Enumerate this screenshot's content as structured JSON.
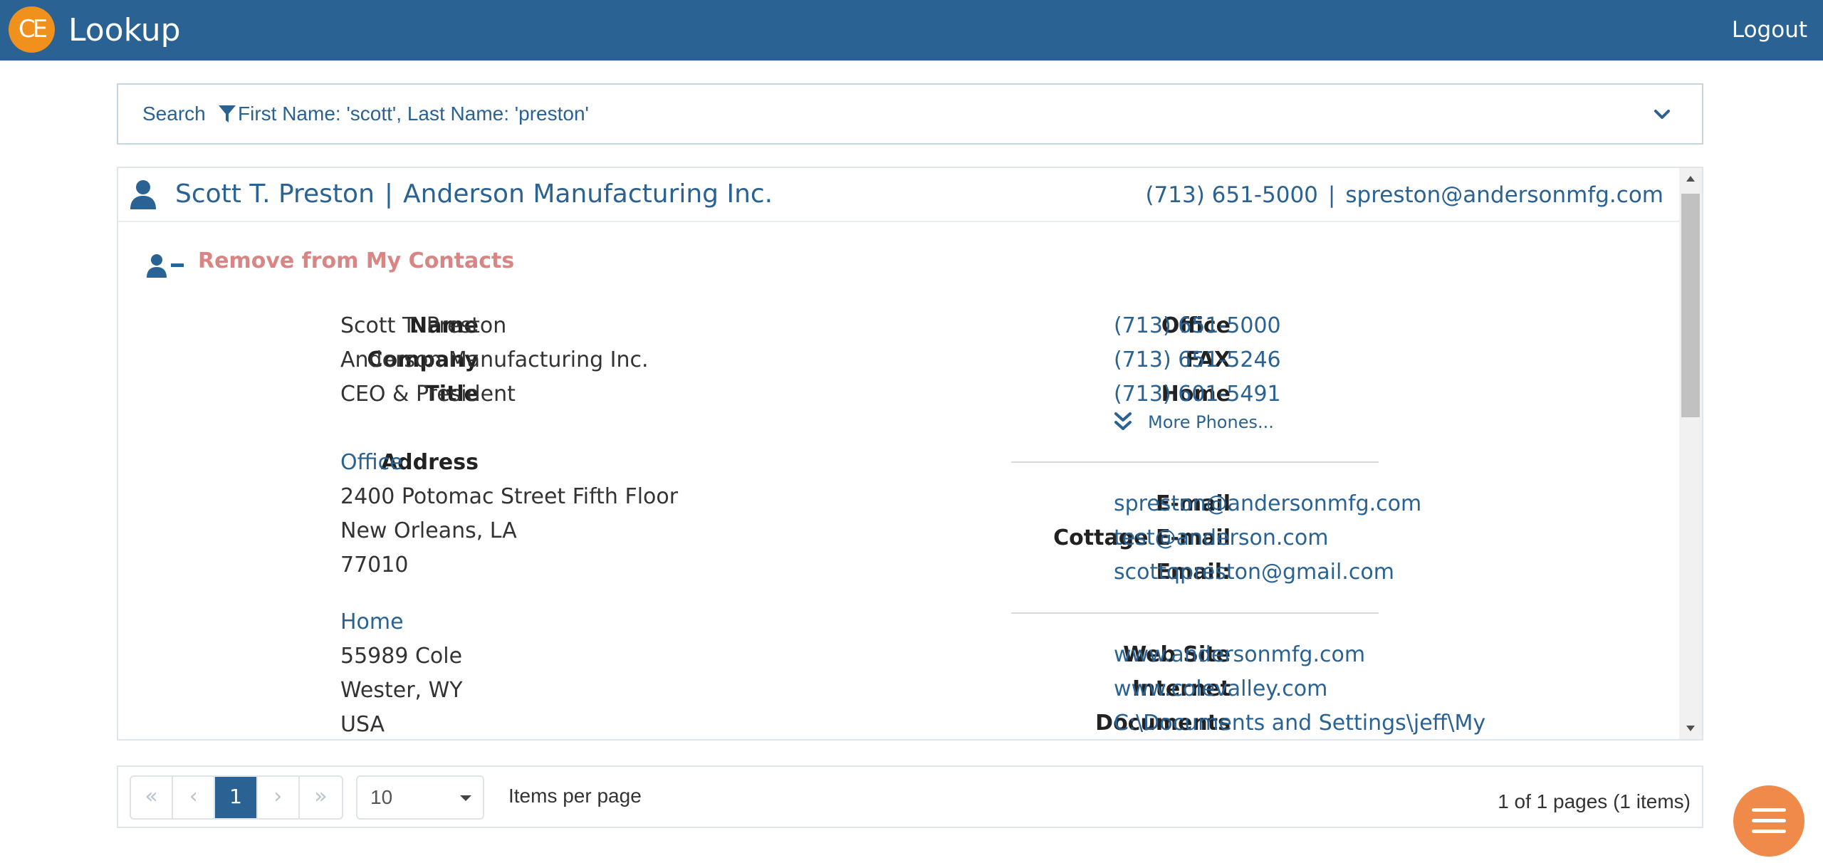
{
  "app": {
    "logo_text": "CE",
    "title": "Lookup",
    "logout_label": "Logout",
    "brand_color": "#2a6293",
    "accent_color": "#f0911d"
  },
  "search": {
    "label": "Search",
    "filter_icon": "filter-icon",
    "filter_text": "First Name: 'scott', Last Name: 'preston'",
    "toggle_icon": "chevron-down-icon"
  },
  "contact": {
    "header": {
      "name": "Scott T. Preston",
      "separator": "|",
      "company": "Anderson Manufacturing Inc.",
      "phone": "(713) 651-5000",
      "email": "spreston@andersonmfg.com"
    },
    "remove_label": "Remove from My Contacts",
    "remove_color": "#d98583",
    "left": {
      "name_label": "Name",
      "name": "Scott T. Preston",
      "company_label": "Company",
      "company": "Anderson Manufacturing Inc.",
      "title_label": "Title",
      "title": "CEO & President",
      "address_label": "Address",
      "addresses": [
        {
          "type": "Office",
          "line1": "2400 Potomac Street Fifth Floor",
          "line2": "New Orleans, LA",
          "line3": "77010"
        },
        {
          "type": "Home",
          "line1": "55989 Cole",
          "line2": "Wester, WY",
          "line3": "USA"
        }
      ]
    },
    "phones": [
      {
        "label": "Office",
        "value": "(713) 651-5000"
      },
      {
        "label": "FAX",
        "value": "(713) 651-5246"
      },
      {
        "label": "Home",
        "value": "(713) 601-5491"
      }
    ],
    "more_phones_label": "More Phones...",
    "emails": [
      {
        "label": "E-mail",
        "value": "spreston@andersonmfg.com"
      },
      {
        "label": "Cottage E-mail",
        "value": "test@anderson.com"
      },
      {
        "label": "Email:",
        "value": "scottqpreston@gmail.com"
      }
    ],
    "web": [
      {
        "label": "Web Site",
        "value": "www.andersonmfg.com"
      },
      {
        "label": "Internet",
        "value": "www.colevalley.com"
      },
      {
        "label": "Documents",
        "value": "C:\\Documents and Settings\\jeff\\My"
      }
    ]
  },
  "pager": {
    "first": "«",
    "prev": "‹",
    "current": "1",
    "next": "›",
    "last": "»",
    "page_size": "10",
    "per_page_label": "Items per page",
    "info": "1 of 1 pages (1 items)"
  },
  "fab": {
    "icon": "hamburger-menu-icon",
    "color": "#f08a4b"
  }
}
